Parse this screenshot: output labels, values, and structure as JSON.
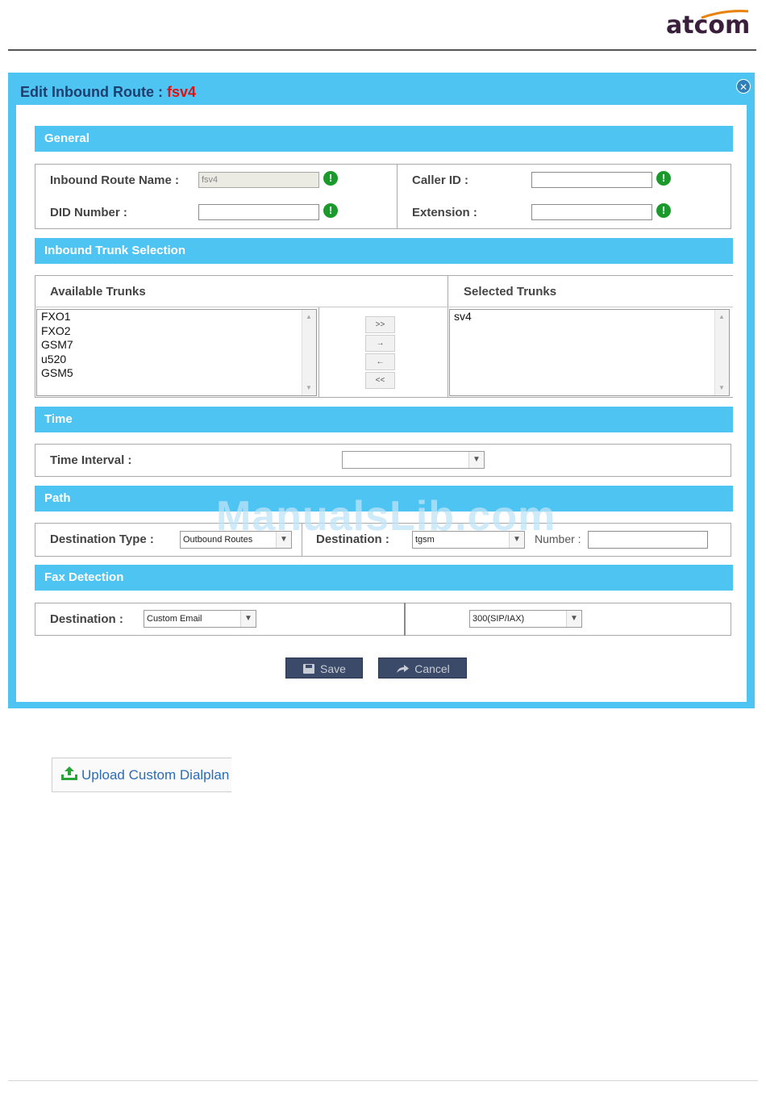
{
  "header": {
    "brand": "atcom"
  },
  "dialog": {
    "title_prefix": "Edit Inbound Route : ",
    "route_name": "fsv4",
    "close_icon": "close-icon",
    "sections": {
      "general": "General",
      "trunks": "Inbound Trunk Selection",
      "time": "Time",
      "path": "Path",
      "fax": "Fax Detection"
    },
    "general": {
      "inbound_route_name_label": "Inbound Route Name :",
      "inbound_route_name_value": "fsv4",
      "caller_id_label": "Caller ID :",
      "caller_id_value": "",
      "did_number_label": "DID Number :",
      "did_number_value": "",
      "extension_label": "Extension :",
      "extension_value": "",
      "required_icon": "exclamation-icon",
      "required_glyph": "!"
    },
    "trunks": {
      "available_label": "Available Trunks",
      "selected_label": "Selected Trunks",
      "available": [
        "FXO1",
        "FXO2",
        "GSM7",
        "u520",
        "GSM5"
      ],
      "selected": [
        "sv4"
      ],
      "buttons": {
        "add_all": ">>",
        "add": "→",
        "remove": "←",
        "remove_all": "<<"
      }
    },
    "time": {
      "interval_label": "Time Interval :",
      "interval_value": ""
    },
    "path": {
      "destination_type_label": "Destination Type :",
      "destination_type_value": "Outbound Routes",
      "destination_label": "Destination :",
      "destination_value": "tgsm",
      "number_label": "Number :",
      "number_value": ""
    },
    "fax": {
      "destination_label": "Destination :",
      "destination_value": "Custom Email",
      "extension_value": "300(SIP/IAX)"
    },
    "buttons": {
      "save": "Save",
      "cancel": "Cancel"
    }
  },
  "watermark": "ManualsLib.com",
  "upload": {
    "label": "Upload Custom Dialplan",
    "icon": "upload-icon"
  },
  "colors": {
    "dialog_blue": "#4ec4f3",
    "title_blue": "#1f3e6d",
    "route_red": "#e01010",
    "button_navy": "#3b4a68",
    "required_green": "#1a9a2a"
  }
}
